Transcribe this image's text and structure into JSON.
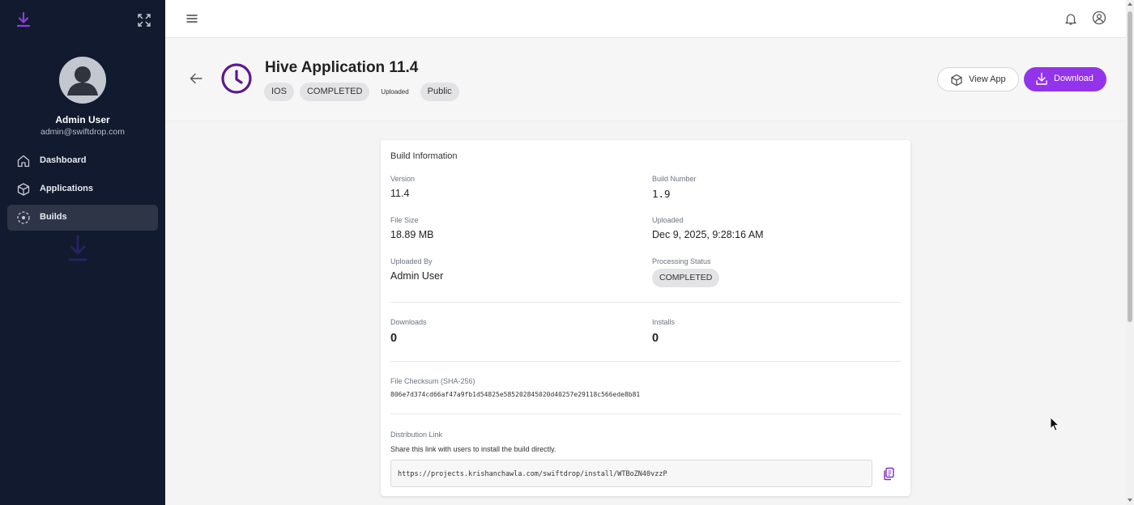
{
  "sidebar": {
    "user_name": "Admin User",
    "user_email": "admin@swiftdrop.com",
    "items": [
      {
        "label": "Dashboard",
        "icon": "home-icon",
        "active": false
      },
      {
        "label": "Applications",
        "icon": "cube-icon",
        "active": false
      },
      {
        "label": "Builds",
        "icon": "builds-icon",
        "active": true
      }
    ]
  },
  "topbar": {
    "icons": [
      "menu-icon",
      "bell-icon",
      "user-circle-icon"
    ]
  },
  "header": {
    "title": "Hive Application 11.4",
    "platform": "IOS",
    "status": "COMPLETED",
    "upload_state": "Uploaded",
    "visibility": "Public",
    "view_app_label": "View App",
    "download_label": "Download"
  },
  "build_info": {
    "section_title": "Build Information",
    "version_label": "Version",
    "version": "11.4",
    "build_number_label": "Build Number",
    "build_number": "1.9",
    "file_size_label": "File Size",
    "file_size": "18.89 MB",
    "uploaded_label": "Uploaded",
    "uploaded": "Dec 9, 2025, 9:28:16 AM",
    "uploaded_by_label": "Uploaded By",
    "uploaded_by": "Admin User",
    "processing_status_label": "Processing Status",
    "processing_status": "COMPLETED",
    "downloads_label": "Downloads",
    "downloads": "0",
    "installs_label": "Installs",
    "installs": "0",
    "checksum_label": "File Checksum (SHA-256)",
    "checksum": "806e7d374cd66af47a9fb1d54825e585202845020d40257e29118c566ede8b81",
    "distribution_label": "Distribution Link",
    "distribution_desc": "Share this link with users to install the build directly.",
    "distribution_url": "https://projects.krishanchawla.com/swiftdrop/install/WTBoZN40vzzP"
  },
  "colors": {
    "sidebar_bg": "#111a2e",
    "accent": "#9333ea",
    "icon_accent": "#5b1a8c"
  }
}
